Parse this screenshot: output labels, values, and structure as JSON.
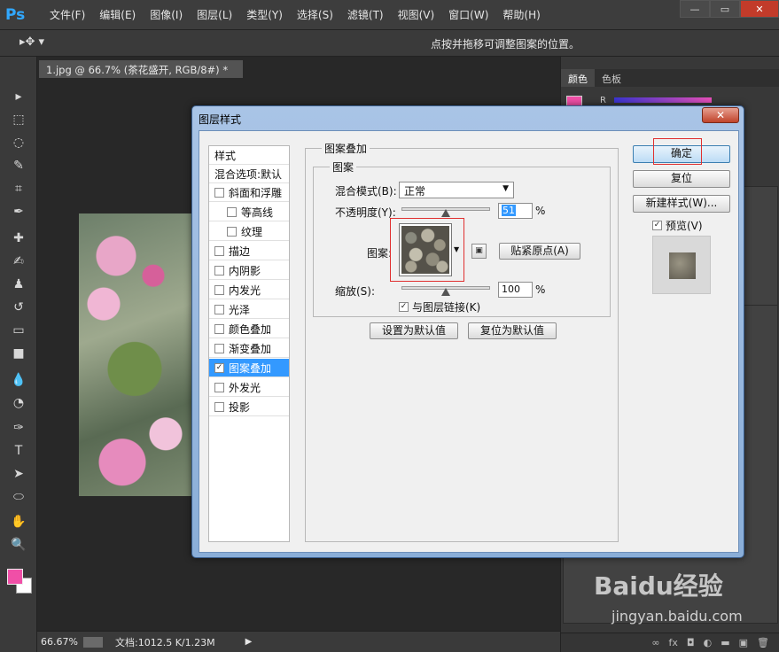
{
  "app": {
    "logo": "Ps",
    "menu": [
      "文件(F)",
      "编辑(E)",
      "图像(I)",
      "图层(L)",
      "类型(Y)",
      "选择(S)",
      "滤镜(T)",
      "视图(V)",
      "窗口(W)",
      "帮助(H)"
    ],
    "window_controls": {
      "minimize": "—",
      "restore": "▭",
      "close": "✕"
    }
  },
  "options_bar": {
    "tool_glyph": "▸✥ ▾",
    "hint": "点按并拖移可调整图案的位置。"
  },
  "document": {
    "tab_title": "1.jpg @ 66.7% (茶花盛开, RGB/8#) *",
    "tab_close": "×"
  },
  "status": {
    "zoom": "66.67%",
    "doc_info": "文档:1012.5 K/1.23M",
    "arrow": "▶"
  },
  "panels": {
    "tabs": [
      "颜色",
      "色板"
    ],
    "fg_color": "#f04fa7",
    "channel_label": "R",
    "bottom_icons": [
      "∞",
      "fx",
      "◘",
      "◐",
      "▬",
      "▣",
      "🗑"
    ]
  },
  "toolbar": {
    "tools": [
      "move-tool-icon",
      "marquee-tool-icon",
      "lasso-tool-icon",
      "quick-select-tool-icon",
      "crop-tool-icon",
      "eyedropper-tool-icon",
      "healing-tool-icon",
      "brush-tool-icon",
      "stamp-tool-icon",
      "history-brush-tool-icon",
      "eraser-tool-icon",
      "gradient-tool-icon",
      "blur-tool-icon",
      "dodge-tool-icon",
      "pen-tool-icon",
      "type-tool-icon",
      "path-select-tool-icon",
      "shape-tool-icon",
      "hand-tool-icon",
      "zoom-tool-icon"
    ],
    "glyphs": [
      "▸",
      "⬚",
      "◌",
      "✎",
      "⌗",
      "✒",
      "✚",
      "✍",
      "♟",
      "↺",
      "▭",
      "■",
      "💧",
      "◔",
      "✑",
      "T",
      "➤",
      "⬭",
      "✋",
      "🔍"
    ],
    "fg_color": "#f04fa7",
    "bg_color": "#ffffff"
  },
  "dialog": {
    "title": "图层样式",
    "close": "✕",
    "styles_header": "样式",
    "blend_header": "混合选项:默认",
    "styles": [
      {
        "label": "斜面和浮雕",
        "checked": false,
        "indent": false
      },
      {
        "label": "等高线",
        "checked": false,
        "indent": true
      },
      {
        "label": "纹理",
        "checked": false,
        "indent": true
      },
      {
        "label": "描边",
        "checked": false,
        "indent": false
      },
      {
        "label": "内阴影",
        "checked": false,
        "indent": false
      },
      {
        "label": "内发光",
        "checked": false,
        "indent": false
      },
      {
        "label": "光泽",
        "checked": false,
        "indent": false
      },
      {
        "label": "颜色叠加",
        "checked": false,
        "indent": false
      },
      {
        "label": "渐变叠加",
        "checked": false,
        "indent": false
      },
      {
        "label": "图案叠加",
        "checked": true,
        "indent": false,
        "selected": true
      },
      {
        "label": "外发光",
        "checked": false,
        "indent": false
      },
      {
        "label": "投影",
        "checked": false,
        "indent": false
      }
    ],
    "section_title": "图案叠加",
    "group_title": "图案",
    "blend_mode_label": "混合模式(B):",
    "blend_mode_value": "正常",
    "opacity_label": "不透明度(Y):",
    "opacity_value": "51",
    "opacity_unit": "%",
    "pattern_label": "图案:",
    "snap_origin_button": "贴紧原点(A)",
    "scale_label": "缩放(S):",
    "scale_value": "100",
    "scale_unit": "%",
    "link_label": "与图层链接(K)",
    "link_checked": "✓",
    "set_default_button": "设置为默认值",
    "reset_default_button": "复位为默认值",
    "ok_button": "确定",
    "reset_button": "复位",
    "new_style_button": "新建样式(W)...",
    "preview_label": "预览(V)",
    "preview_checked": "✓"
  },
  "watermark": {
    "brand": "Baidu经验",
    "site": "jingyan.baidu.com"
  }
}
